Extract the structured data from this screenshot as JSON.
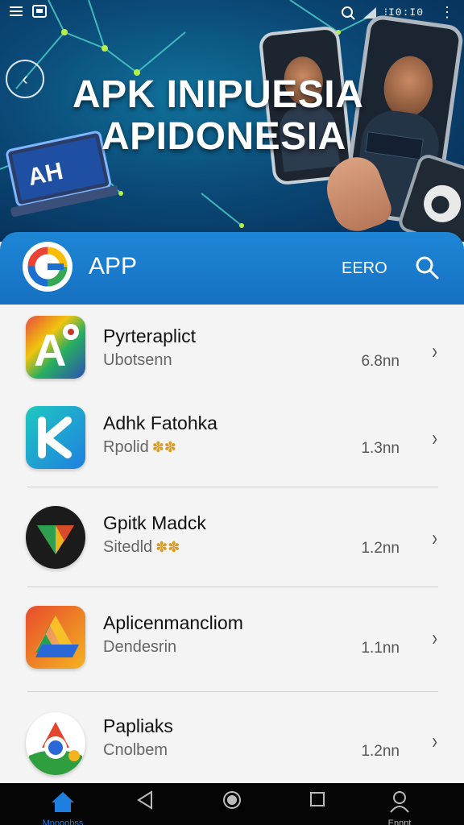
{
  "status_bar": {
    "time": "⁝I0:I0",
    "icons": [
      "menu-icon",
      "image-icon",
      "search-icon",
      "signal-icon",
      "more-icon"
    ]
  },
  "hero": {
    "title_line1": "APK INIPUESIA",
    "title_line2": "APIDONESIA",
    "laptop_screen_text": "AH"
  },
  "app_bar": {
    "title": "APP",
    "action_label": "EERO",
    "colors": {
      "bar": "#1a7bcf"
    }
  },
  "apps": [
    {
      "name": "Pyrteraplict",
      "subtitle": "Ubotsenn",
      "badge": "",
      "size": "6.8nn",
      "icon": "app-a-icon"
    },
    {
      "name": "Adhk Fatohka",
      "subtitle": "Rpolid",
      "badge": "✽✽",
      "size": "1.3nn",
      "icon": "app-k-icon"
    },
    {
      "name": "Gpitk Madck",
      "subtitle": "Sitedld",
      "badge": "✽✽",
      "size": "1.2nn",
      "icon": "app-v-icon"
    },
    {
      "name": "Aplicenmancliom",
      "subtitle": "Dendesrin",
      "badge": "",
      "size": "1.1nn",
      "icon": "app-drive-icon"
    },
    {
      "name": "Papliaks",
      "subtitle": "Cnolbem",
      "badge": "",
      "size": "1.2nn",
      "icon": "app-chrome-icon"
    }
  ],
  "nav_bar": {
    "home_label": "Mnpoobss",
    "profile_label": "Ennnt"
  }
}
